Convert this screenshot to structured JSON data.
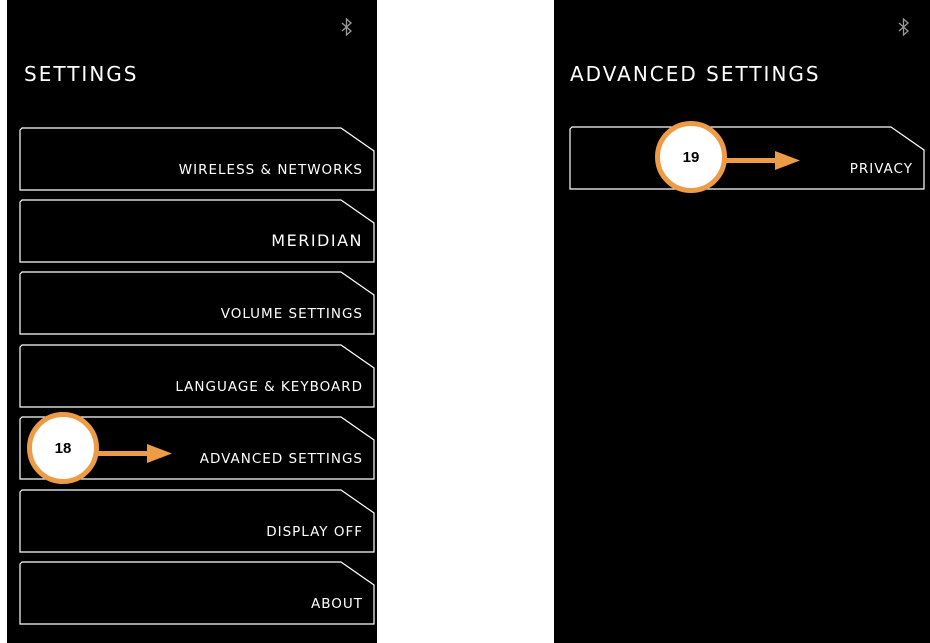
{
  "left_screen": {
    "title": "SETTINGS",
    "items": [
      {
        "label": "WIRELESS & NETWORKS"
      },
      {
        "label": "MERIDIAN"
      },
      {
        "label": "VOLUME SETTINGS"
      },
      {
        "label": "LANGUAGE & KEYBOARD"
      },
      {
        "label": "ADVANCED SETTINGS"
      },
      {
        "label": "DISPLAY OFF"
      },
      {
        "label": "ABOUT"
      }
    ],
    "callout_number": "18"
  },
  "right_screen": {
    "title": "ADVANCED SETTINGS",
    "items": [
      {
        "label": "PRIVACY"
      }
    ],
    "callout_number": "19"
  },
  "colors": {
    "screen_bg": "#000000",
    "text": "#ffffff",
    "callout_accent": "#ee9b47"
  },
  "icons": [
    "bluetooth-icon",
    "meridian-logo-icon",
    "arrow-right-icon"
  ]
}
